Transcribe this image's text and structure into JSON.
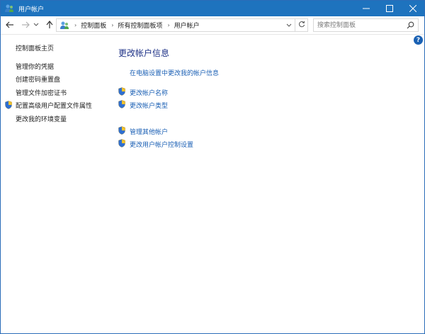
{
  "window": {
    "title": "用户帐户",
    "accent_color": "#1e73be"
  },
  "titlebar_controls": {
    "minimize_icon": "minimize-icon",
    "maximize_icon": "maximize-icon",
    "close_icon": "close-icon"
  },
  "address_bar": {
    "breadcrumbs": [
      "控制面板",
      "所有控制面板项",
      "用户帐户"
    ],
    "search_placeholder": "搜索控制面板"
  },
  "left_pane": {
    "home_link": "控制面板主页",
    "tasks": [
      {
        "label": "管理你的凭据",
        "shield": false
      },
      {
        "label": "创建密码重置盘",
        "shield": false
      },
      {
        "label": "管理文件加密证书",
        "shield": false
      },
      {
        "label": "配置高级用户配置文件属性",
        "shield": true
      },
      {
        "label": "更改我的环境变量",
        "shield": false
      }
    ]
  },
  "main": {
    "title": "更改帐户信息",
    "pc_settings_link": "在电脑设置中更改我的帐户信息",
    "links_group1": [
      {
        "label": "更改帐户名称",
        "shield": true
      },
      {
        "label": "更改帐户类型",
        "shield": true
      }
    ],
    "links_group2": [
      {
        "label": "管理其他帐户",
        "shield": true
      },
      {
        "label": "更改用户帐户控制设置",
        "shield": true
      }
    ]
  },
  "help": {
    "label": "?"
  }
}
